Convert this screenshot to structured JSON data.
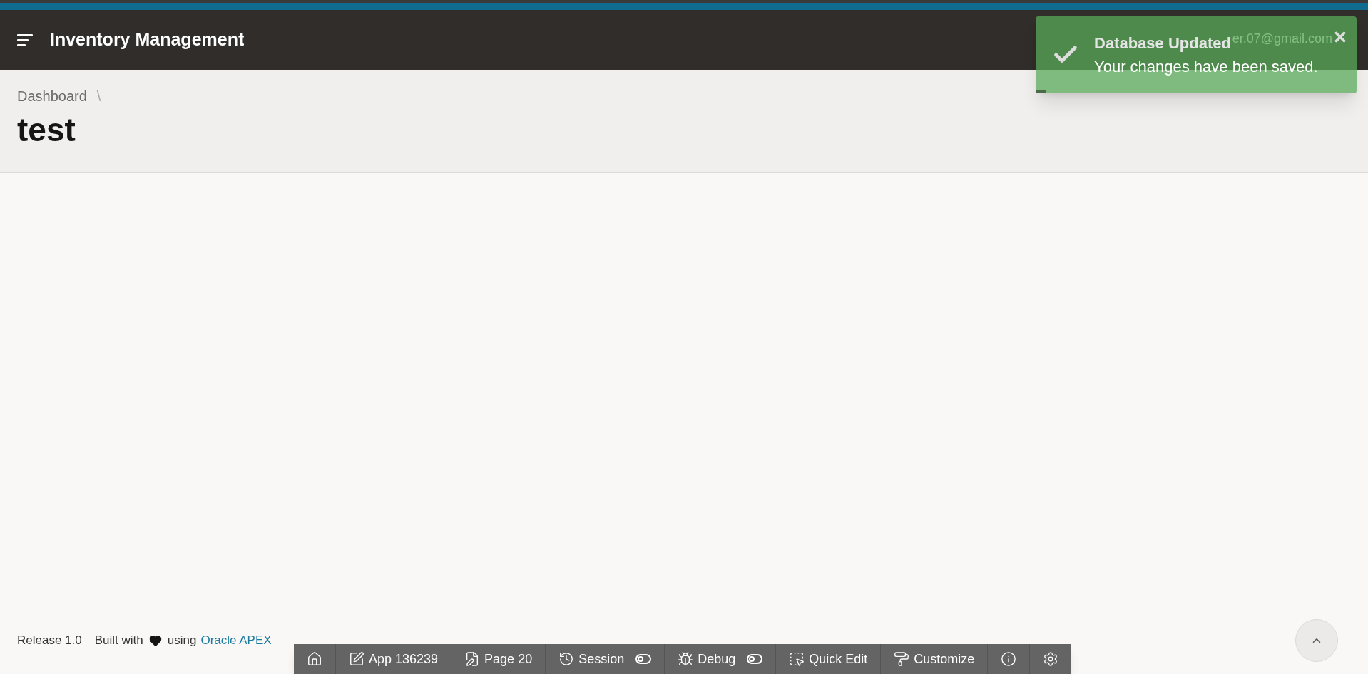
{
  "header": {
    "title": "Inventory Management",
    "user": "er.07@gmail.com"
  },
  "breadcrumb": {
    "items": [
      "Dashboard"
    ],
    "separator": "\\",
    "title": "test"
  },
  "footer": {
    "release": "Release 1.0",
    "built_with": "Built with",
    "using": "using",
    "link": "Oracle APEX"
  },
  "toast": {
    "title": "Database Updated",
    "message": "Your changes have been saved.",
    "level": 0.03
  },
  "dev_toolbar": [
    {
      "kind": "home"
    },
    {
      "kind": "app",
      "label": "App 136239"
    },
    {
      "kind": "page",
      "label": "Page 20"
    },
    {
      "kind": "session",
      "label": "Session",
      "on": false
    },
    {
      "kind": "debug",
      "label": "Debug",
      "on": false
    },
    {
      "kind": "quick_edit",
      "label": "Quick Edit"
    },
    {
      "kind": "customize",
      "label": "Customize"
    },
    {
      "kind": "info"
    },
    {
      "kind": "settings"
    }
  ]
}
